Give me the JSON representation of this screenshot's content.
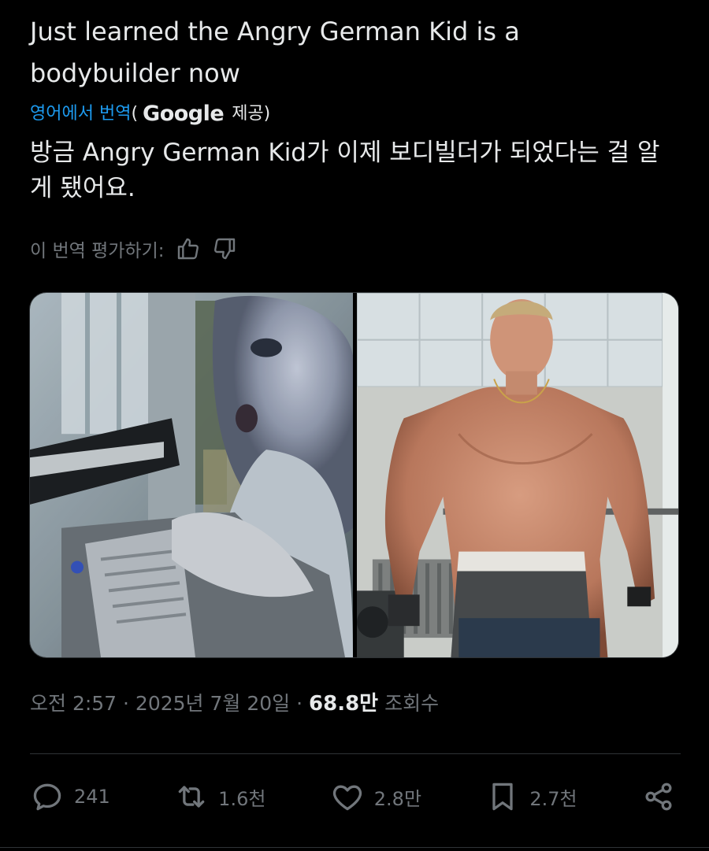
{
  "post": {
    "original_text": "Just learned the Angry German Kid is a bodybuilder now",
    "translation_label": {
      "link": "영어에서 번역",
      "open_paren": "(",
      "provider": "Google",
      "provided": "제공)"
    },
    "translated_text": "방금 Angry German Kid가 이제 보디빌더가 되었다는 걸 알게 됐어요.",
    "rate_translation": "이 번역 평가하기:",
    "icons": {
      "thumbs_up": "thumbs-up-icon",
      "thumbs_down": "thumbs-down-icon"
    },
    "timestamp": "오전 2:57 · 2025년 7월 20일 · ",
    "views_count": "68.8만",
    "views_label": "조회수"
  },
  "actions": {
    "reply_count": "241",
    "repost_count": "1.6천",
    "like_count": "2.8만",
    "bookmark_count": "2.7천"
  },
  "colors": {
    "background": "#000000",
    "text_primary": "#e7e9ea",
    "text_secondary": "#71767b",
    "link": "#1d9bf0",
    "border": "#2f3336"
  }
}
